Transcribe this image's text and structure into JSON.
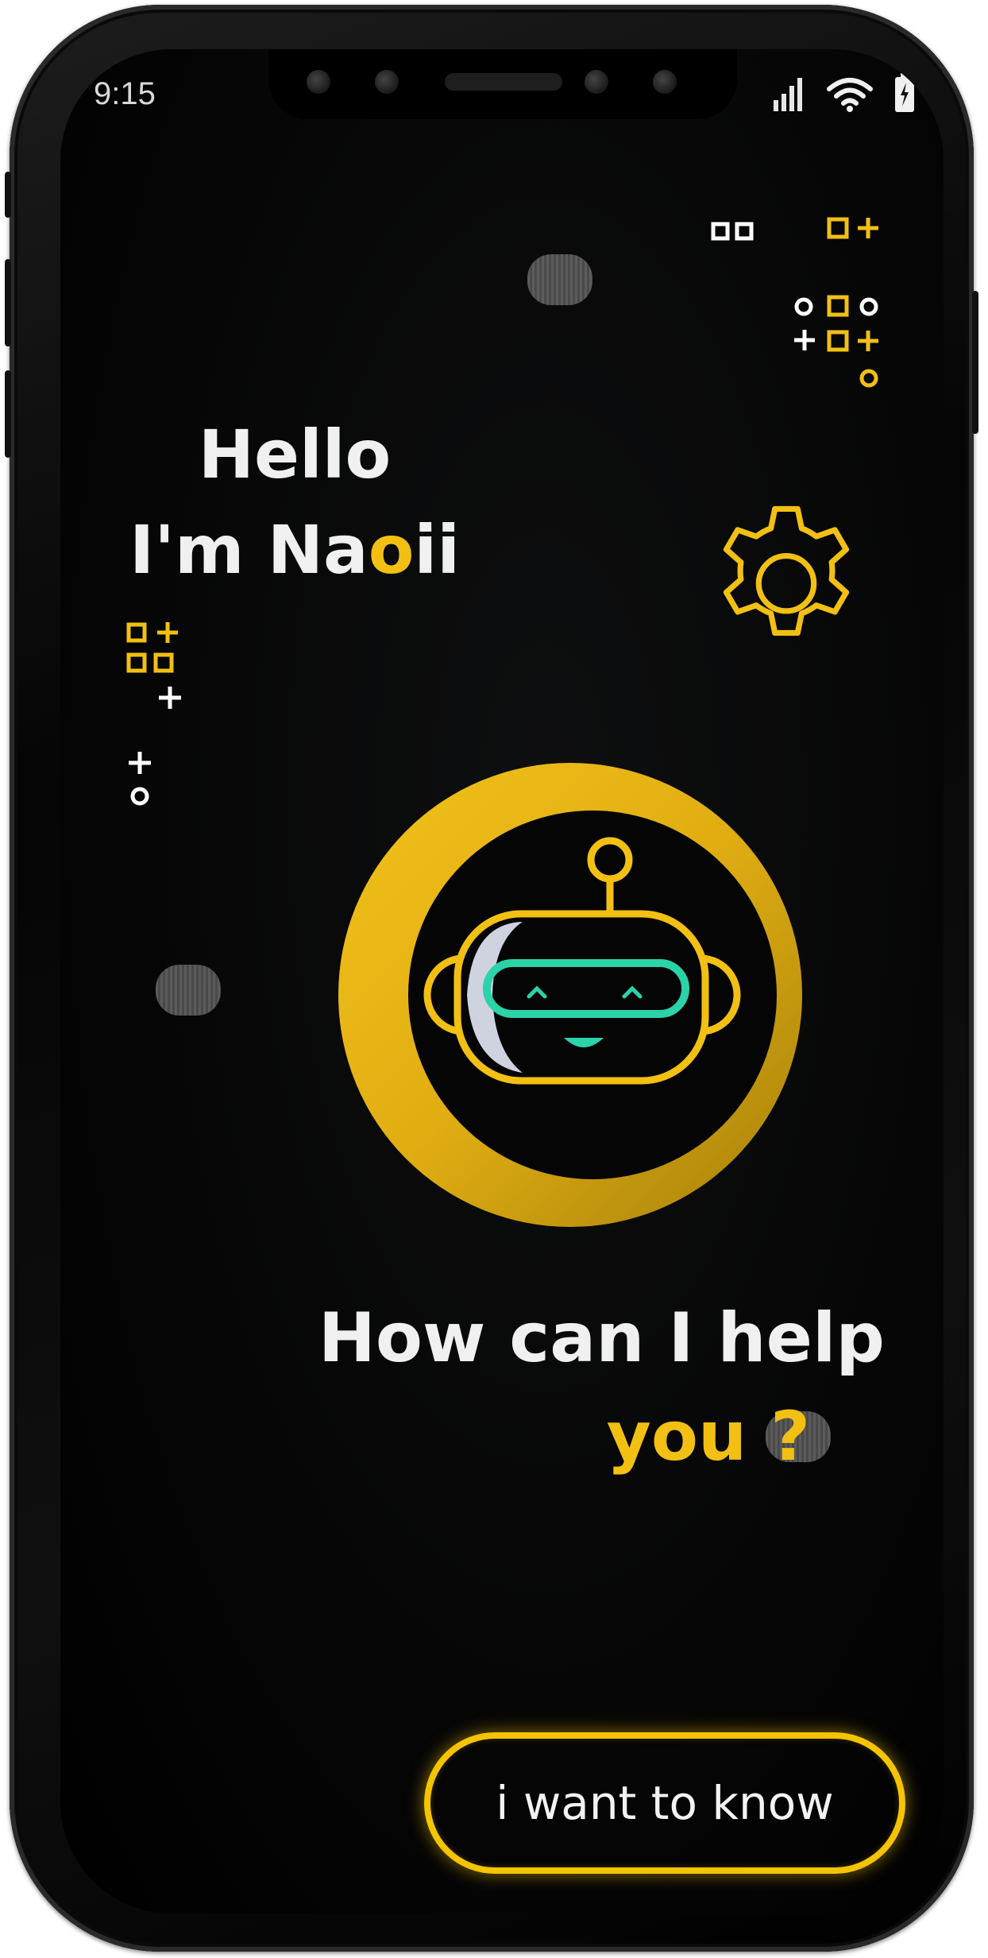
{
  "status_bar": {
    "time": "9:15",
    "icons": [
      "signal-icon",
      "wifi-icon",
      "battery-icon"
    ]
  },
  "greeting": {
    "line1": "Hello",
    "line2_prefix": "I'm Na",
    "line2_accent": "o",
    "line2_suffix": "ii"
  },
  "question": {
    "line1": "How can I help",
    "line2": "you ?"
  },
  "cta_button": {
    "label": "i want to know"
  },
  "colors": {
    "accent": "#f2c013",
    "robot_visor": "#2ad3a8",
    "background": "#050505",
    "text": "#f0f0f0"
  },
  "decor_icons": [
    "gear-icon",
    "robot-icon",
    "grid-symbols-icon"
  ]
}
